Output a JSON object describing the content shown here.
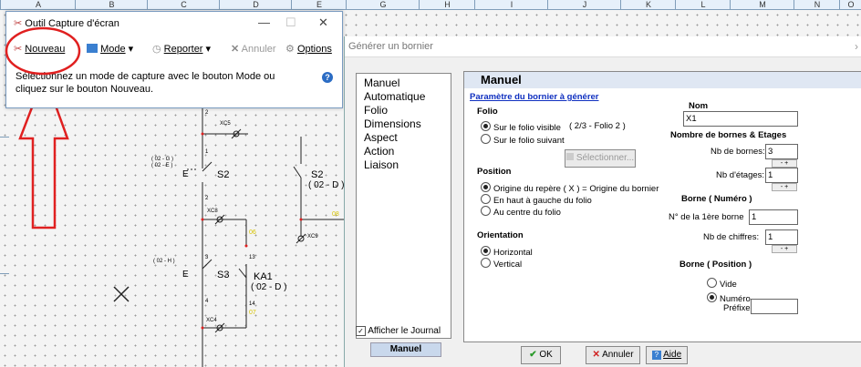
{
  "spreadsheet": {
    "columns": [
      "A",
      "B",
      "C",
      "D",
      "E",
      "G",
      "H",
      "I",
      "J",
      "K",
      "L",
      "M",
      "N",
      "O"
    ]
  },
  "snipping_tool": {
    "title": "Outil Capture d'écran",
    "toolbar": {
      "new_label": "Nouveau",
      "mode_label": "Mode",
      "delay_label": "Reporter",
      "cancel_label": "Annuler",
      "options_label": "Options"
    },
    "message": "Sélectionnez un mode de capture avec le bouton Mode ou cliquez sur le bouton Nouveau."
  },
  "schematic": {
    "labels": {
      "s2a": "S2",
      "s2b": "S2",
      "s2b_ref": "( 02 - D )",
      "s3": "S3",
      "ka1": "KA1",
      "ka1_ref": "( 02 - D )",
      "xc5": "XC5",
      "xc8": "XC8",
      "xc9": "XC9",
      "xc4": "XC4",
      "ref_g": "( 02 - G )",
      "ref_e": "( 02 - E )",
      "ref_h": "( 02 - H )",
      "e1": "E",
      "e2": "E",
      "n1": "1",
      "n2": "2",
      "n2b": "2",
      "n3": "3",
      "n4": "4",
      "n13": "13",
      "n14": "14",
      "y06": "06",
      "y07": "07",
      "y08": "08",
      "y05": "05"
    }
  },
  "dialog": {
    "title": "Générer un bornier",
    "nav": [
      "Manuel",
      "Automatique",
      "Folio",
      "Dimensions",
      "Aspect",
      "Action",
      "Liaison"
    ],
    "journal_label": "Afficher le Journal",
    "active_tab": "Manuel",
    "panel": {
      "heading": "Manuel",
      "param_link": "Paramètre du bornier à générer",
      "folio_title": "Folio",
      "folio_opt1": "Sur le folio visible",
      "folio_info": "( 2/3 - Folio 2 )",
      "folio_opt2": "Sur le folio suivant",
      "select_btn": "Sélectionner...",
      "position_title": "Position",
      "pos_opt1": "Origine du repère ( X ) = Origine du bornier",
      "pos_opt2": "En haut à gauche du folio",
      "pos_opt3": "Au centre du folio",
      "orientation_title": "Orientation",
      "orient_opt1": "Horizontal",
      "orient_opt2": "Vertical",
      "nom_title": "Nom",
      "nom_value": "X1",
      "bornes_title": "Nombre de bornes & Etages",
      "nb_bornes_label": "Nb de bornes:",
      "nb_bornes_value": "3",
      "nb_etages_label": "Nb d'étages:",
      "nb_etages_value": "1",
      "borne_num_title": "Borne ( Numéro )",
      "first_borne_label": "N° de la 1ère borne",
      "first_borne_value": "1",
      "nb_chiffres_label": "Nb de chiffres:",
      "nb_chiffres_value": "1",
      "borne_pos_title": "Borne ( Position )",
      "vide_label": "Vide",
      "numero_label": "Numéro",
      "prefixe_label": "Préfixe",
      "prefixe_value": ""
    },
    "buttons": {
      "ok": "OK",
      "cancel": "Annuler",
      "help": "Aide"
    }
  },
  "colors": {
    "annotation_red": "#e02020",
    "header_blue": "#dfe7f3",
    "yellow_label": "#d8c400"
  }
}
